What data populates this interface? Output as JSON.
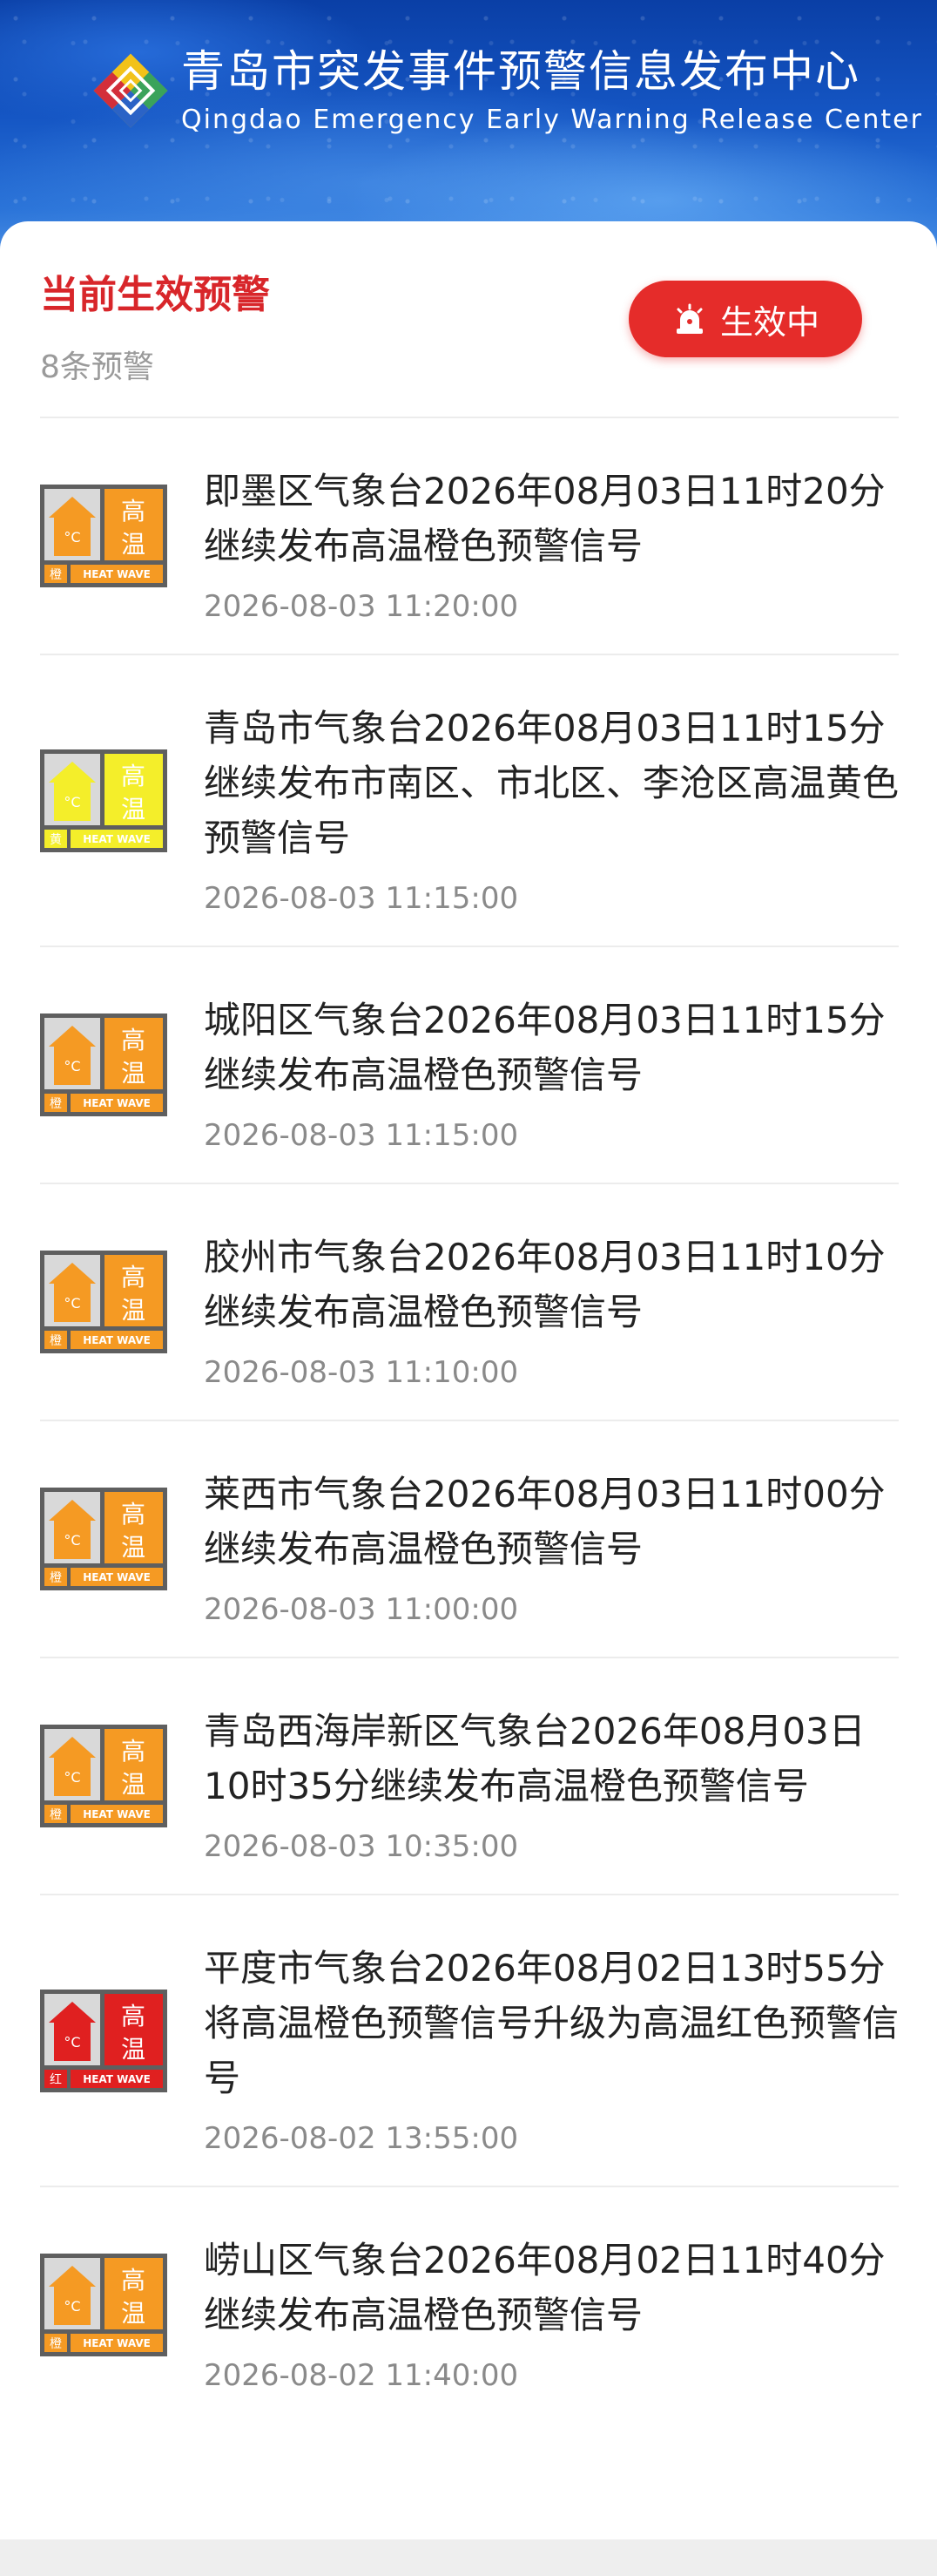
{
  "header": {
    "title_cn": "青岛市突发事件预警信息发布中心",
    "title_en": "Qingdao Emergency Early Warning Release Center",
    "logo_icon": "qingdao-emergency-logo-icon"
  },
  "section": {
    "title": "当前生效预警",
    "count": "8条预警",
    "status_button": "生效中",
    "status_icon": "alarm-bell-icon"
  },
  "colors": {
    "accent_red": "#d8262a",
    "orange": "#f59a23",
    "yellow": "#f4ee2a",
    "red": "#e02020"
  },
  "sign_labels": {
    "high": "高",
    "temp": "温",
    "heat_wave": "HEAT WAVE",
    "celsius": "°C",
    "orange_level": "橙",
    "yellow_level": "黄",
    "red_level": "红"
  },
  "warnings": [
    {
      "text": "即墨区气象台2026年08月03日11时20分继续发布高温橙色预警信号",
      "time": "2026-08-03 11:20:00",
      "level": "orange"
    },
    {
      "text": "青岛市气象台2026年08月03日11时15分继续发布市南区、市北区、李沧区高温黄色预警信号",
      "time": "2026-08-03 11:15:00",
      "level": "yellow"
    },
    {
      "text": "城阳区气象台2026年08月03日11时15分继续发布高温橙色预警信号",
      "time": "2026-08-03 11:15:00",
      "level": "orange"
    },
    {
      "text": "胶州市气象台2026年08月03日11时10分继续发布高温橙色预警信号",
      "time": "2026-08-03 11:10:00",
      "level": "orange"
    },
    {
      "text": "莱西市气象台2026年08月03日11时00分继续发布高温橙色预警信号",
      "time": "2026-08-03 11:00:00",
      "level": "orange"
    },
    {
      "text": "青岛西海岸新区气象台2026年08月03日10时35分继续发布高温橙色预警信号",
      "time": "2026-08-03 10:35:00",
      "level": "orange"
    },
    {
      "text": "平度市气象台2026年08月02日13时55分将高温橙色预警信号升级为高温红色预警信号",
      "time": "2026-08-02 13:55:00",
      "level": "red"
    },
    {
      "text": "崂山区气象台2026年08月02日11时40分继续发布高温橙色预警信号",
      "time": "2026-08-02 11:40:00",
      "level": "orange"
    }
  ]
}
